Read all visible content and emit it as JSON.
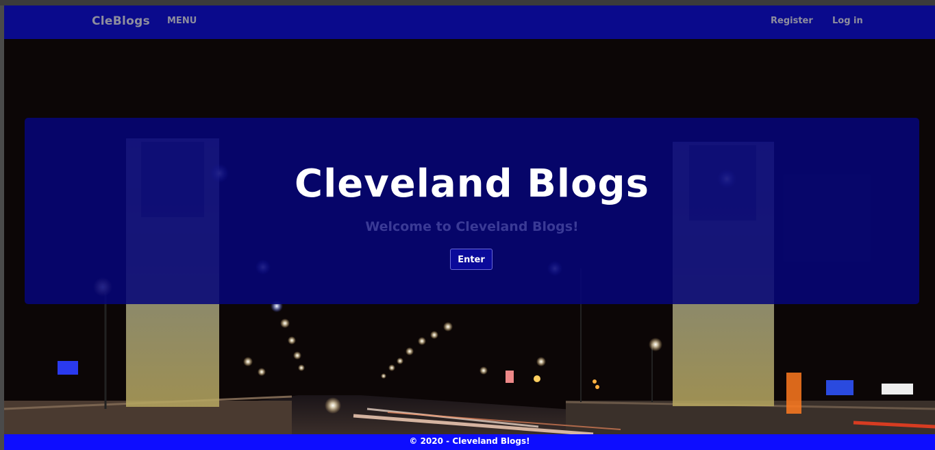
{
  "navbar": {
    "brand": "CleBlogs",
    "menu_label": "MENU",
    "register_label": "Register",
    "login_label": "Log in"
  },
  "hero": {
    "title": "Cleveland Blogs",
    "subtitle": "Welcome to Cleveland Blogs!",
    "button_label": "Enter"
  },
  "footer": {
    "text": "© 2020 - Cleveland Blogs!"
  },
  "colors": {
    "navbar_bg": "#0a0a8c",
    "jumbotron_bg": "#06067a",
    "footer_bg": "#0d0dff",
    "nav_text": "#8e8e9e",
    "subtitle_text": "#3a3a96"
  }
}
